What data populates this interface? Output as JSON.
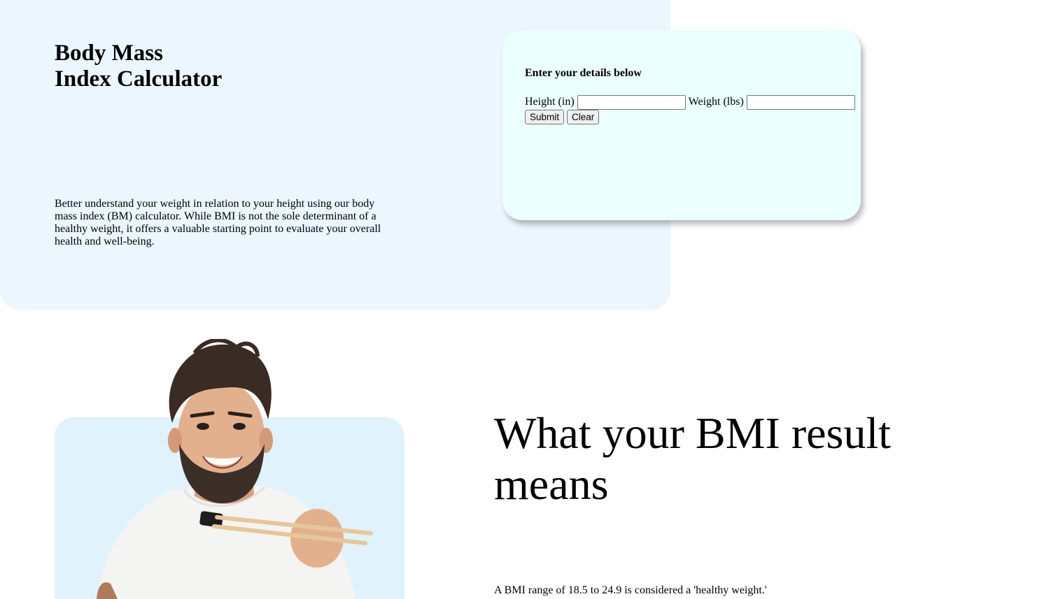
{
  "hero": {
    "title_line1": "Body Mass",
    "title_line2": "Index Calculator",
    "description": "Better understand your weight in relation to your height using our body mass index (BM) calculator. While BMI is not the sole determinant of a healthy weight, it offers a valuable starting point to evaluate your overall health and well-being."
  },
  "form": {
    "heading": "Enter your details below",
    "height_label": "Height (in)",
    "height_value": "",
    "weight_label": "Weight (lbs)",
    "weight_value": "",
    "submit_label": "Submit",
    "clear_label": "Clear"
  },
  "results": {
    "title": "What your BMI result means",
    "note": "A BMI range of 18.5 to 24.9 is considered a 'healthy weight.'"
  },
  "colors": {
    "hero_bg": "#ebf6ff",
    "form_bg": "#ebffff",
    "photo_bg": "#e0f2fc"
  }
}
